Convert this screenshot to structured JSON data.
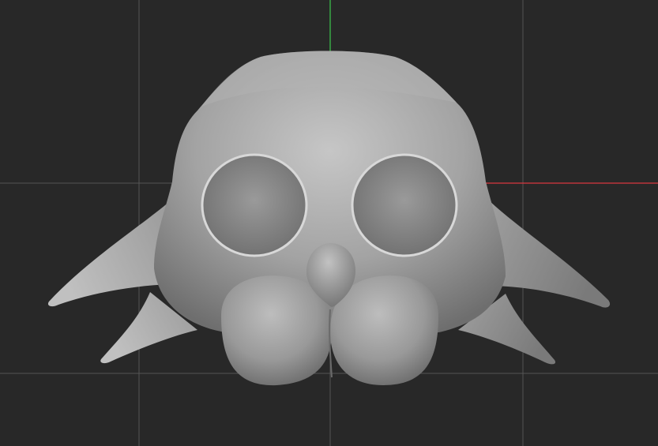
{
  "viewport": {
    "background_color": "#282828",
    "grid_color": "#5a5a5a",
    "axis_y_color": "#3cc94c",
    "axis_x_color": "#d9373f"
  },
  "model": {
    "object": "mask-sculpt",
    "base_color": "#9c9c9c",
    "highlight_color": "#c4c4c4",
    "shadow_color": "#555555"
  }
}
